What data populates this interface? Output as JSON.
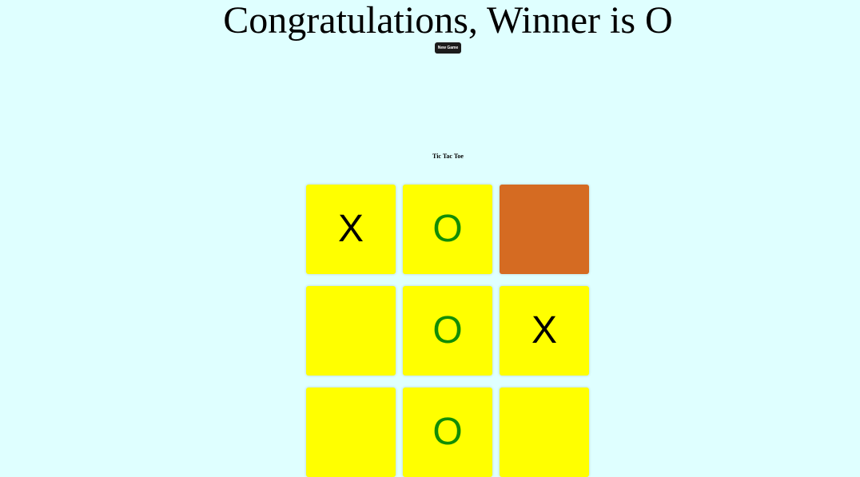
{
  "status": {
    "message": "Congratulations, Winner is O",
    "new_game_label": "New Game"
  },
  "game": {
    "title": "Tic Tac Toe"
  },
  "colors": {
    "background": "#dfffff",
    "cell_default": "#ffff00",
    "cell_highlight": "#d56b22",
    "x_mark": "#000000",
    "o_mark": "#128d05",
    "button_bg": "#1c1c1c"
  },
  "board": {
    "cells": [
      {
        "mark": "X",
        "highlighted": false
      },
      {
        "mark": "O",
        "highlighted": false
      },
      {
        "mark": "",
        "highlighted": true
      },
      {
        "mark": "",
        "highlighted": false
      },
      {
        "mark": "O",
        "highlighted": false
      },
      {
        "mark": "X",
        "highlighted": false
      },
      {
        "mark": "",
        "highlighted": false
      },
      {
        "mark": "O",
        "highlighted": false
      },
      {
        "mark": "",
        "highlighted": false
      }
    ]
  }
}
